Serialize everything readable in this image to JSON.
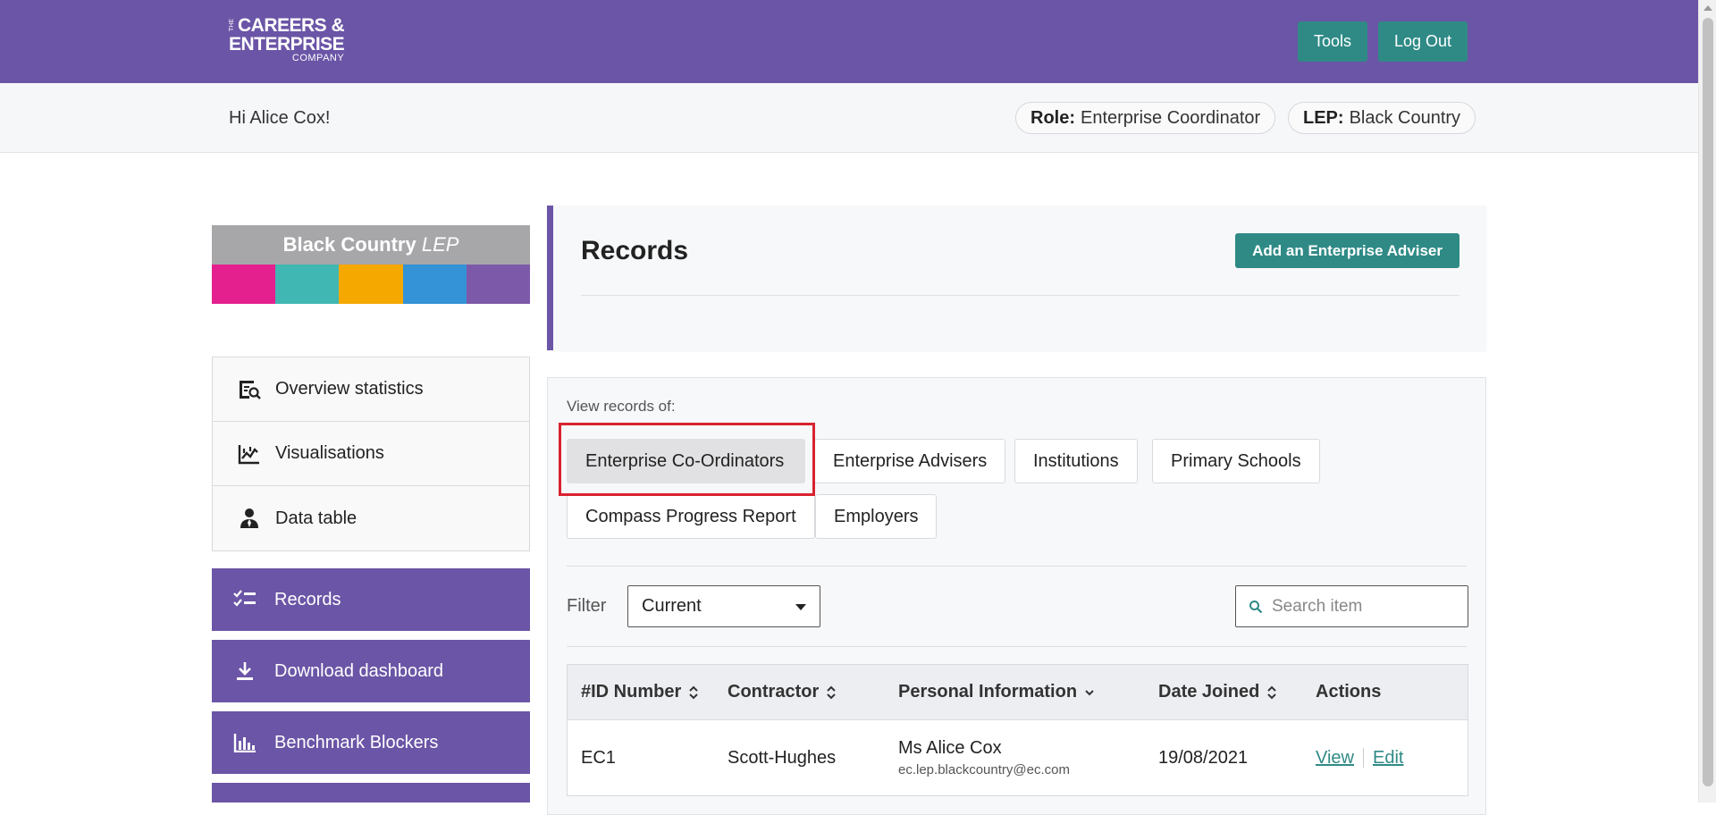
{
  "header": {
    "logo": {
      "line1": "CAREERS &",
      "line2": "ENTERPRISE",
      "line3": "COMPANY",
      "prefix": "THE"
    },
    "tools_label": "Tools",
    "logout_label": "Log Out"
  },
  "subbar": {
    "greeting": "Hi Alice Cox!",
    "role_label": "Role:",
    "role_value": "Enterprise Coordinator",
    "lep_label": "LEP:",
    "lep_value": "Black Country"
  },
  "sidebar": {
    "banner": {
      "name": "Black Country",
      "suffix": "LEP",
      "stripe_colors": [
        "#e4208e",
        "#40b7b2",
        "#f5a800",
        "#3492d6",
        "#7d5aa9"
      ]
    },
    "nav_items": [
      {
        "label": "Overview statistics",
        "icon": "chart-search-icon"
      },
      {
        "label": "Visualisations",
        "icon": "trend-chart-icon"
      },
      {
        "label": "Data table",
        "icon": "person-icon"
      }
    ],
    "buttons": [
      {
        "label": "Records",
        "icon": "checklist-icon"
      },
      {
        "label": "Download dashboard",
        "icon": "download-icon"
      },
      {
        "label": "Benchmark Blockers",
        "icon": "bar-chart-icon"
      }
    ]
  },
  "records": {
    "title": "Records",
    "add_button_label": "Add an Enterprise Adviser"
  },
  "panel": {
    "view_label": "View records of:",
    "chips": [
      "Enterprise Co-Ordinators",
      "Enterprise Advisers",
      "Institutions",
      "Primary Schools",
      "Compass Progress Report",
      "Employers"
    ],
    "filter_label": "Filter",
    "filter_value": "Current",
    "search_placeholder": "Search item"
  },
  "table": {
    "headers": [
      "#ID Number",
      "Contractor",
      "Personal Information",
      "Date Joined",
      "Actions"
    ],
    "rows": [
      {
        "id": "EC1",
        "contractor": "Scott-Hughes",
        "name": "Ms Alice Cox",
        "email": "ec.lep.blackcountry@ec.com",
        "date_joined": "19/08/2021",
        "view_label": "View",
        "edit_label": "Edit"
      }
    ]
  },
  "colors": {
    "brand_purple": "#6b55a6",
    "teal": "#2f8a86",
    "highlight_red": "#d9222f"
  }
}
